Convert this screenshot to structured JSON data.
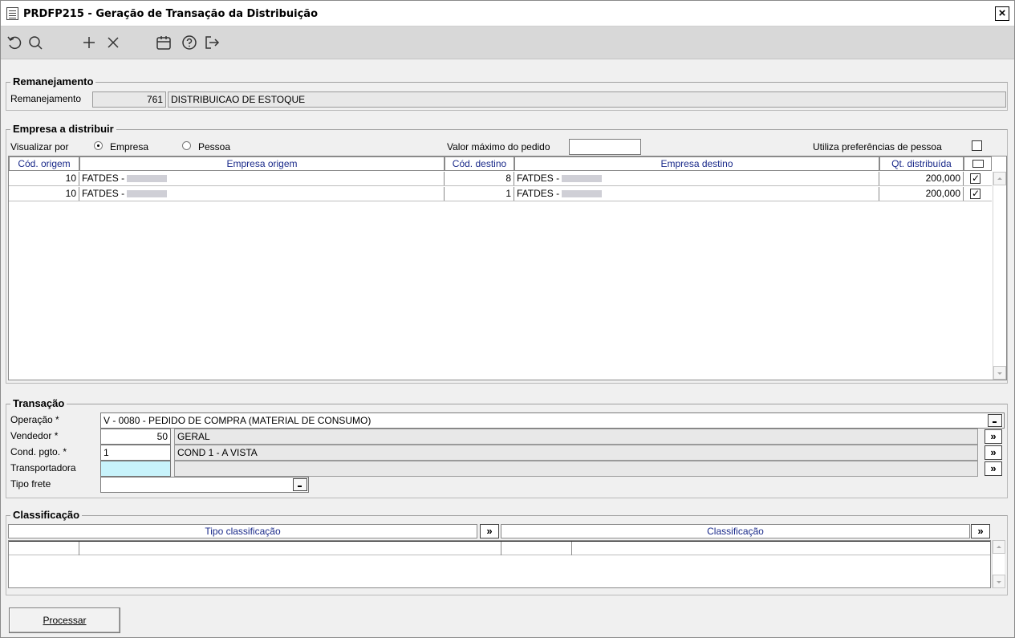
{
  "window": {
    "title": "PRDFP215 - Geração de Transação da Distribuição",
    "close_label": "×"
  },
  "toolbar": {
    "icons": [
      "refresh-icon",
      "search-icon",
      "add-icon",
      "delete-icon",
      "calendar-icon",
      "help-icon",
      "exit-icon"
    ]
  },
  "remanejamento": {
    "group_title": "Remanejamento",
    "label": "Remanejamento",
    "code": "761",
    "description": "DISTRIBUICAO DE ESTOQUE"
  },
  "empresa": {
    "group_title": "Empresa a distribuir",
    "visualizar_label": "Visualizar por",
    "radio_empresa": "Empresa",
    "radio_pessoa": "Pessoa",
    "valor_max_label": "Valor máximo do pedido",
    "valor_max_value": "",
    "preferencias_label": "Utiliza preferências de pessoa",
    "columns": [
      "Cód. origem",
      "Empresa origem",
      "Cód. destino",
      "Empresa destino",
      "Qt. distribuída"
    ],
    "rows": [
      {
        "cod_origem": "10",
        "empresa_origem": "FATDES -",
        "cod_destino": "8",
        "empresa_destino": "FATDES -",
        "qt": "200,000"
      },
      {
        "cod_origem": "10",
        "empresa_origem": "FATDES -",
        "cod_destino": "1",
        "empresa_destino": "FATDES -",
        "qt": "200,000"
      }
    ]
  },
  "transacao": {
    "group_title": "Transação",
    "operacao_label": "Operação *",
    "operacao_value": "V - 0080 - PEDIDO DE COMPRA (MATERIAL DE CONSUMO)",
    "vendedor_label": "Vendedor *",
    "vendedor_code": "50",
    "vendedor_name": "GERAL",
    "cond_label": "Cond. pgto. *",
    "cond_code": "1",
    "cond_name": "COND 1 - A VISTA",
    "transportadora_label": "Transportadora",
    "tipo_frete_label": "Tipo frete",
    "lookup_label": "»"
  },
  "classificacao": {
    "group_title": "Classificação",
    "col_tipo": "Tipo classificação",
    "col_class": "Classificação",
    "lookup_label": "»"
  },
  "actions": {
    "processar_label": "Processar"
  }
}
